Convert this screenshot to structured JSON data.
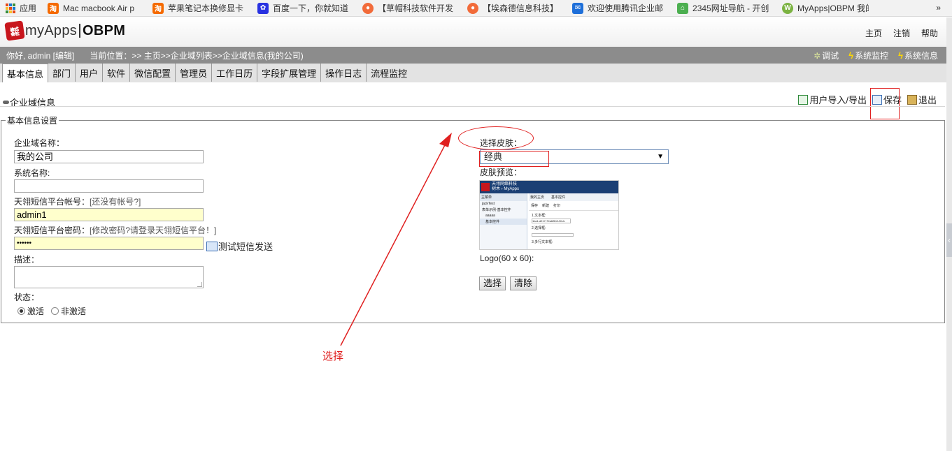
{
  "bookmarks": [
    {
      "label": "应用",
      "icon": "apps-grid-icon"
    },
    {
      "label": "Mac macbook Air p",
      "icon": "taobao-icon",
      "color": "#f56a00"
    },
    {
      "label": "苹果笔记本换修显卡",
      "icon": "taobao-icon",
      "color": "#f56a00"
    },
    {
      "label": "百度一下，你就知道",
      "icon": "baidu-paw-icon",
      "color": "#2932e1"
    },
    {
      "label": "【草帽科技软件开发",
      "icon": "site-icon",
      "color": "#f26b3a"
    },
    {
      "label": "【埃森德信息科技】",
      "icon": "site-icon",
      "color": "#f26b3a"
    },
    {
      "label": "欢迎使用腾讯企业邮",
      "icon": "tencent-mail-icon",
      "color": "#1e6fd9"
    },
    {
      "label": "2345网址导航 - 开创",
      "icon": "2345-icon",
      "color": "#4caf50"
    },
    {
      "label": "MyApps|OBPM 我的",
      "icon": "myapps-icon",
      "color": "#7cb342"
    }
  ],
  "bookmarks_more": "»",
  "header": {
    "logo_mark": "㍿",
    "logo_text": "myApps",
    "logo_bold": "OBPM",
    "links": [
      "主页",
      "注销",
      "帮助"
    ]
  },
  "infobar": {
    "greeting": "你好, admin [编辑]",
    "location": "当前位置：>> 主页>>企业域列表>>企业域信息(我的公司)",
    "tools": [
      {
        "label": "调试",
        "icon": "bug-icon"
      },
      {
        "label": "系统监控",
        "icon": "lightning-icon"
      },
      {
        "label": "系统信息",
        "icon": "lightning-icon"
      }
    ]
  },
  "tabs": [
    "基本信息",
    "部门",
    "用户",
    "软件",
    "微信配置",
    "管理员",
    "工作日历",
    "字段扩展管理",
    "操作日志",
    "流程监控"
  ],
  "section": {
    "title": "企业域信息",
    "actions": [
      {
        "label": "用户导入/导出",
        "icon": "import-export-icon"
      },
      {
        "label": "保存",
        "icon": "save-icon"
      },
      {
        "label": "退出",
        "icon": "exit-icon"
      }
    ]
  },
  "form": {
    "legend": "基本信息设置",
    "domain_name_label": "企业域名称：",
    "domain_name_value": "我的公司",
    "system_name_label": "系统名称:",
    "system_name_value": "",
    "sms_account_label": "天翎短信平台帐号：",
    "sms_account_hint": "[还没有帐号?]",
    "sms_account_value": "admin1",
    "sms_password_label": "天翎短信平台密码：",
    "sms_password_hint": "[修改密码?请登录天翎短信平台！]",
    "sms_password_value": "••••••",
    "test_sms_label": "测试短信发送",
    "description_label": "描述：",
    "status_label": "状态：",
    "status_options": [
      "激活",
      "非激活"
    ],
    "status_selected": "激活",
    "skin_label": "选择皮肤：",
    "skin_value": "经典",
    "skin_preview_label": "皮肤预览：",
    "logo_label": "Logo(60 x 60):",
    "choose_button": "选择",
    "clear_button": "清除"
  },
  "preview": {
    "title": "天翎网络科技",
    "subtitle": "树木 › MyApps",
    "menu_header": "主菜单",
    "tab": "我的主页",
    "tab2": "基本控件",
    "btn_save": "保存",
    "btn_new": "新建",
    "btn_exit": "打印",
    "side_items": [
      "jackTest",
      "表单示例·基本控件",
      "aaaaa",
      "基本控件"
    ],
    "field1": "1.文本框:",
    "field1_value": "11a1-d217-72a62fb0-9fc4-",
    "field2": "2.选择框:",
    "field3": "3.多行文本框:"
  },
  "annotation": {
    "note": "选择"
  }
}
